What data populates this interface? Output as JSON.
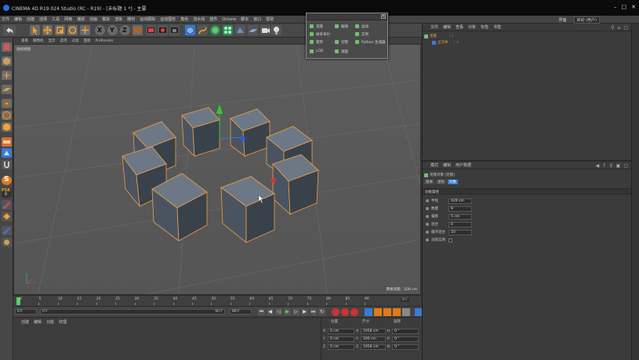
{
  "window": {
    "title": "CINEMA 4D R19.024 Studio (RC - R19) - [未标题 1 *] - 主要"
  },
  "menu": {
    "items": [
      "文件",
      "编辑",
      "创建",
      "选择",
      "工具",
      "网格",
      "捕捉",
      "动画",
      "模拟",
      "渲染",
      "雕刻",
      "运动跟踪",
      "运动图形",
      "角色",
      "流水线",
      "插件",
      "Octane",
      "脚本",
      "窗口",
      "帮助"
    ],
    "interface_label": "界面",
    "layout_value": "启动 (用户)"
  },
  "toolbar": {
    "axis_labels": [
      "X",
      "Y",
      "Z"
    ]
  },
  "viewport": {
    "menu": [
      "查看",
      "摄像机",
      "显示",
      "选项",
      "过滤",
      "面板",
      "ProRender"
    ],
    "name": "透视视图",
    "grid_spacing": "网格间距：100 cm"
  },
  "popup": {
    "items_col1": [
      "克隆",
      "破碎(Voronoi)",
      "矩阵",
      "LOD"
    ],
    "items_col2": [
      "融球",
      "运动挤压",
      "多边形FX",
      "运动文本"
    ],
    "items_col3": [
      "运动",
      "实例",
      "Python 生成器",
      ""
    ],
    "visible": [
      {
        "label": "克隆"
      },
      {
        "label": "融球"
      },
      {
        "label": "运动"
      },
      {
        "label": "样条布尔"
      },
      {
        "label": "实例"
      },
      {
        "label": "矩阵"
      },
      {
        "label": "切割"
      },
      {
        "label": "Python 生成器"
      },
      {
        "label": "LOD"
      },
      {
        "label": "减面"
      }
    ]
  },
  "objmgr": {
    "menu": [
      "文件",
      "编辑",
      "查看",
      "对象",
      "标签",
      "书签"
    ],
    "objects": [
      {
        "name": "克隆"
      },
      {
        "name": "立方体"
      }
    ]
  },
  "attrmgr": {
    "menu": [
      "模式",
      "编辑",
      "用户数据"
    ],
    "object_title": "克隆对象 [克隆]",
    "tabs": [
      "基本",
      "坐标",
      "对象"
    ],
    "section": "对象属性",
    "fields": [
      {
        "label": "半径",
        "value": "429 cm"
      },
      {
        "label": "数量",
        "value": "9"
      },
      {
        "label": "偏移",
        "value": "5 cm"
      },
      {
        "label": "混合",
        "value": "0"
      },
      {
        "label": "循环混合",
        "value": "10"
      },
      {
        "label": "渲染实例",
        "value": ""
      }
    ]
  },
  "timeline": {
    "ticks": [
      "0",
      "5",
      "10",
      "15",
      "20",
      "25",
      "30",
      "35",
      "40",
      "45",
      "50",
      "55",
      "60",
      "65",
      "70",
      "75",
      "80",
      "85",
      "90"
    ],
    "current": "0 F",
    "start": "0 F",
    "end": "90 F",
    "field_left": "0 F",
    "field_mid": "90 F"
  },
  "matpanel": {
    "menu": [
      "创建",
      "编辑",
      "功能",
      "纹理"
    ]
  },
  "coords": {
    "headers": [
      "位置",
      "尺寸",
      "旋转"
    ],
    "rows": [
      {
        "axis": "X",
        "pos": "0 cm",
        "size_axis": "X",
        "size": "1058 cm",
        "rot_axis": "H",
        "rot": "0 °"
      },
      {
        "axis": "Y",
        "pos": "0 cm",
        "size_axis": "Y",
        "size": "200 cm",
        "rot_axis": "P",
        "rot": "0 °"
      },
      {
        "axis": "Z",
        "pos": "0 cm",
        "size_axis": "Z",
        "size": "1058 cm",
        "rot_axis": "B",
        "rot": "0 °"
      }
    ]
  },
  "colors": {
    "accent": "#f08c2c",
    "green": "#6cc46c",
    "blue": "#3a7bd5"
  }
}
